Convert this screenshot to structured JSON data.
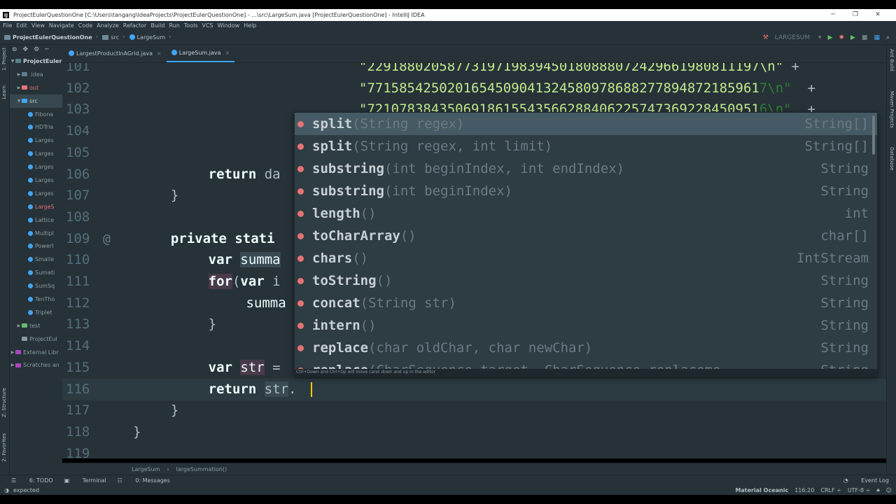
{
  "window": {
    "title": "ProjectEulerQuestionOne [C:\\Users\\tangang\\IdeaProjects\\ProjectEulerQuestionOne] - ...\\src\\LargeSum.java [ProjectEulerQuestionOne] - IntelliJ IDEA",
    "app_icon": "IJ"
  },
  "menu": [
    "File",
    "Edit",
    "View",
    "Navigate",
    "Code",
    "Analyze",
    "Refactor",
    "Build",
    "Run",
    "Tools",
    "VCS",
    "Window",
    "Help"
  ],
  "breadcrumbs": [
    "ProjectEulerQuestionOne",
    "src",
    "LargeSum"
  ],
  "run_config": "LARGESUM",
  "left_tabs": [
    "1: Project",
    "Learn",
    "Z: Structure",
    "2: Favorites"
  ],
  "right_tabs": [
    "Ant Build",
    "Maven Projects",
    "Database"
  ],
  "project_panel": {
    "root": "ProjectEuler",
    "rows": [
      {
        "label": ".idea",
        "kind": "folder",
        "indent": 1
      },
      {
        "label": "out",
        "kind": "folder",
        "indent": 1,
        "red": true
      },
      {
        "label": "src",
        "kind": "folder",
        "indent": 1,
        "open": true,
        "selected": true
      },
      {
        "label": "Fibona",
        "kind": "class",
        "indent": 2
      },
      {
        "label": "HDTria",
        "kind": "class",
        "indent": 2
      },
      {
        "label": "Larges",
        "kind": "class",
        "indent": 2
      },
      {
        "label": "Larges",
        "kind": "class",
        "indent": 2
      },
      {
        "label": "Larges",
        "kind": "class",
        "indent": 2
      },
      {
        "label": "Larges",
        "kind": "class",
        "indent": 2
      },
      {
        "label": "Larges",
        "kind": "class",
        "indent": 2
      },
      {
        "label": "LargeS",
        "kind": "class",
        "indent": 2,
        "red": true
      },
      {
        "label": "Lattice",
        "kind": "class",
        "indent": 2
      },
      {
        "label": "Multipl",
        "kind": "class",
        "indent": 2
      },
      {
        "label": "PowerI",
        "kind": "class",
        "indent": 2
      },
      {
        "label": "Smalle",
        "kind": "class",
        "indent": 2
      },
      {
        "label": "Sumati",
        "kind": "class",
        "indent": 2
      },
      {
        "label": "SumSq",
        "kind": "class",
        "indent": 2
      },
      {
        "label": "TenTho",
        "kind": "class",
        "indent": 2
      },
      {
        "label": "Triplet",
        "kind": "class",
        "indent": 2
      },
      {
        "label": "test",
        "kind": "folder",
        "indent": 1
      },
      {
        "label": "ProjectEul",
        "kind": "file",
        "indent": 1
      },
      {
        "label": "External Libr",
        "kind": "lib",
        "indent": 0
      },
      {
        "label": "Scratches an",
        "kind": "lib",
        "indent": 0
      }
    ]
  },
  "tabs": [
    {
      "label": "LargestProductInAGrid.java",
      "active": false
    },
    {
      "label": "LargeSum.java",
      "active": true
    }
  ],
  "code_lines": [
    {
      "n": "101",
      "html": "<span class=\"str\">\"2291880205877319719839450180888072429661980811197\\n\"</span> +",
      "indent": 24
    },
    {
      "n": "102",
      "html": "<span class=\"str\">\"7715854250201654509041324580978688277894872185961</span><span class=\"green\">7\\n\"</span>  +",
      "indent": 24
    },
    {
      "n": "103",
      "html": "<span class=\"str\">\"7210783843506918615543566288406225747369228450951</span><span class=\"green\">6\\n\"</span>  +",
      "indent": 24
    },
    {
      "n": "104",
      "html": "<span class=\"str\">\"</span>",
      "indent": 24
    },
    {
      "n": "105",
      "html": "<span class=\"str\">\"</span>",
      "indent": 24
    },
    {
      "n": "106",
      "html": "<span class=\"kw2\">return</span> da",
      "indent": 8
    },
    {
      "n": "107",
      "html": "}",
      "indent": 4
    },
    {
      "n": "108",
      "html": "",
      "indent": 0
    },
    {
      "n": "109",
      "html": "<span class=\"kw2\">private</span> <span class=\"kw2\">stati</span>",
      "indent": 4,
      "at": true
    },
    {
      "n": "110",
      "html": "<span class=\"kw2\">var</span> <span class=\"var hl\">summa</span>",
      "indent": 8
    },
    {
      "n": "111",
      "html": "<span class=\"kw2 hlp\">for</span>(<span class=\"kw2\">var</span> i",
      "indent": 8
    },
    {
      "n": "112",
      "html": "<span class=\"var\">summa</span>",
      "indent": 12
    },
    {
      "n": "113",
      "html": "}",
      "indent": 8
    },
    {
      "n": "114",
      "html": "",
      "indent": 0
    },
    {
      "n": "115",
      "html": "<span class=\"kw2\">var</span> <span class=\"var hlp\">str</span> =",
      "indent": 8
    },
    {
      "n": "116",
      "html": "<span class=\"kw2\">return</span> <span class=\"hl\">str</span>.",
      "indent": 8,
      "current": true
    },
    {
      "n": "117",
      "html": "}",
      "indent": 4
    },
    {
      "n": "118",
      "html": "}",
      "indent": 0
    },
    {
      "n": "119",
      "html": "",
      "indent": 0
    }
  ],
  "completion": {
    "items": [
      {
        "name": "split",
        "params": "(String regex)",
        "type": "String[]",
        "selected": true
      },
      {
        "name": "split",
        "params": "(String regex, int limit)",
        "type": "String[]"
      },
      {
        "name": "substring",
        "params": "(int beginIndex, int endIndex)",
        "type": "String"
      },
      {
        "name": "substring",
        "params": "(int beginIndex)",
        "type": "String"
      },
      {
        "name": "length",
        "params": "()",
        "type": "int"
      },
      {
        "name": "toCharArray",
        "params": "()",
        "type": "char[]"
      },
      {
        "name": "chars",
        "params": "()",
        "type": "IntStream"
      },
      {
        "name": "toString",
        "params": "()",
        "type": "String"
      },
      {
        "name": "concat",
        "params": "(String str)",
        "type": "String"
      },
      {
        "name": "intern",
        "params": "()",
        "type": "String"
      },
      {
        "name": "replace",
        "params": "(char oldChar, char newChar)",
        "type": "String"
      },
      {
        "name": "replace",
        "params": "(CharSequence target, CharSequence replaceme",
        "type": "String"
      }
    ],
    "hint": "Ctrl+Down and Ctrl+Up will move caret down and up in the editor"
  },
  "editor_breadcrumb": [
    "LargeSum",
    "largeSummation()"
  ],
  "bottom_tools": [
    "6: TODO",
    "Terminal",
    "0: Messages"
  ],
  "event_log": "Event Log",
  "status": {
    "message": "expected",
    "theme": "Material Oceanic",
    "position": "116:20",
    "line_sep": "CRLF ÷",
    "encoding": "UTF-8 ÷"
  },
  "colors": {
    "background": "#263238",
    "accent": "#42a5f5",
    "string": "#c3e88d"
  }
}
